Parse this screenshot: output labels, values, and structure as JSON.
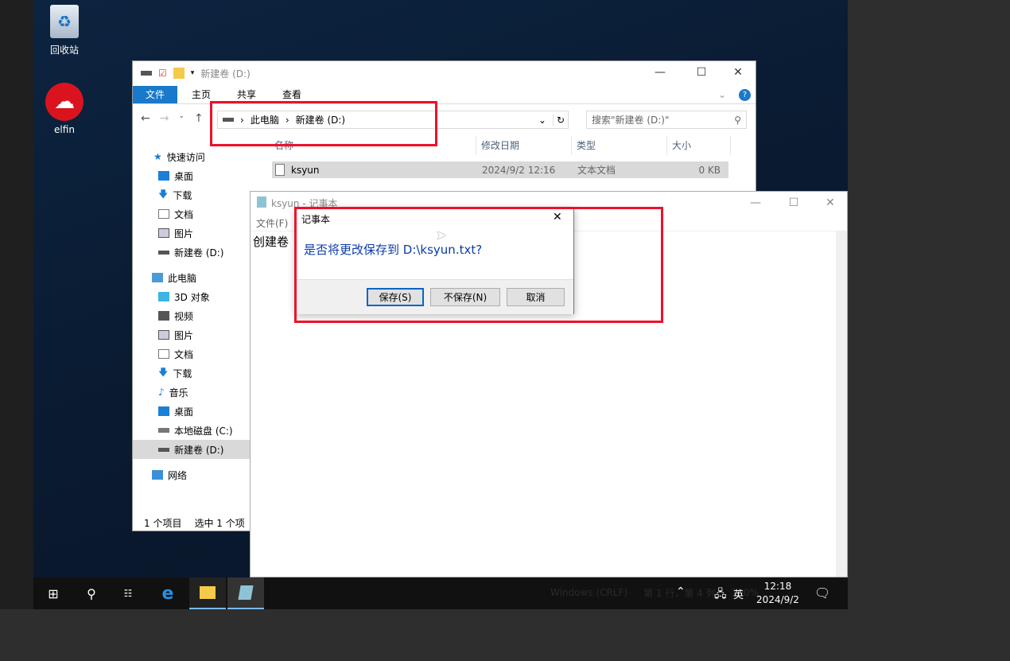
{
  "desktop": {
    "icons": [
      {
        "label": "回收站"
      },
      {
        "label": "elfin"
      }
    ]
  },
  "explorer": {
    "title": "新建卷 (D:)",
    "ribbon_tabs": [
      "文件",
      "主页",
      "共享",
      "查看"
    ],
    "breadcrumb": [
      "此电脑",
      "新建卷 (D:)"
    ],
    "search_placeholder": "搜索\"新建卷 (D:)\"",
    "columns": [
      "名称",
      "修改日期",
      "类型",
      "大小"
    ],
    "files": [
      {
        "name": "ksyun",
        "date": "2024/9/2 12:16",
        "type": "文本文档",
        "size": "0 KB"
      }
    ],
    "nav": {
      "quick_access": "快速访问",
      "quick_items": [
        "桌面",
        "下载",
        "文档",
        "图片",
        "新建卷 (D:)"
      ],
      "this_pc": "此电脑",
      "pc_items": [
        "3D 对象",
        "视频",
        "图片",
        "文档",
        "下载",
        "音乐",
        "桌面",
        "本地磁盘 (C:)",
        "新建卷 (D:)"
      ],
      "network": "网络"
    },
    "status": {
      "count": "1 个项目",
      "selected": "选中 1 个项"
    }
  },
  "notepad": {
    "title": "ksyun - 记事本",
    "menu": "文件(F)",
    "content": "创建卷",
    "status": {
      "encoding": "Windows (CRLF)",
      "position": "第 1 行，第 4 列",
      "zoom": "100%"
    }
  },
  "dialog": {
    "title": "记事本",
    "message": "是否将更改保存到 D:\\ksyun.txt?",
    "save": "保存(S)",
    "dont_save": "不保存(N)",
    "cancel": "取消"
  },
  "taskbar": {
    "time": "12:18",
    "date": "2024/9/2",
    "ime": "英"
  },
  "colors": {
    "accent": "#1979ca",
    "highlight": "#f0102a"
  }
}
